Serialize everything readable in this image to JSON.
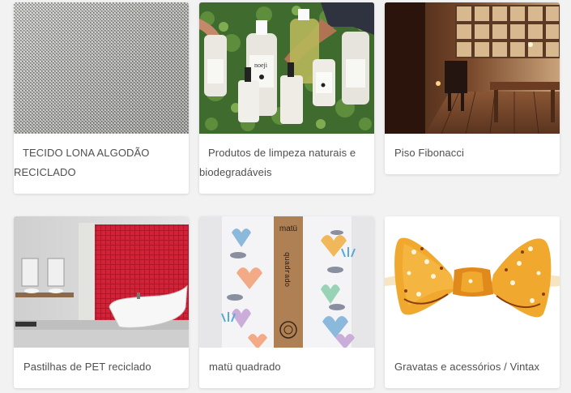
{
  "products": [
    {
      "title": "TECIDO LONA ALGODÃO RECICLADO",
      "image": "gray-canvas-fabric"
    },
    {
      "title": "Produtos de limpeza naturais e biodegradáveis",
      "image": "cleaning-bottles-on-ivy"
    },
    {
      "title": "Piso Fibonacci",
      "image": "wooden-library-interior"
    },
    {
      "title": "Pastilhas de PET reciclado",
      "image": "bathroom-red-tiles"
    },
    {
      "title": "matü quadrado",
      "image": "printed-cloth-with-kraft-band"
    },
    {
      "title": "Gravatas e acessórios / Vintax",
      "image": "orange-bow-tie"
    }
  ],
  "image_text": {
    "bottle_label": "noeji",
    "band_brand": "matü",
    "band_name": "quadrado"
  }
}
